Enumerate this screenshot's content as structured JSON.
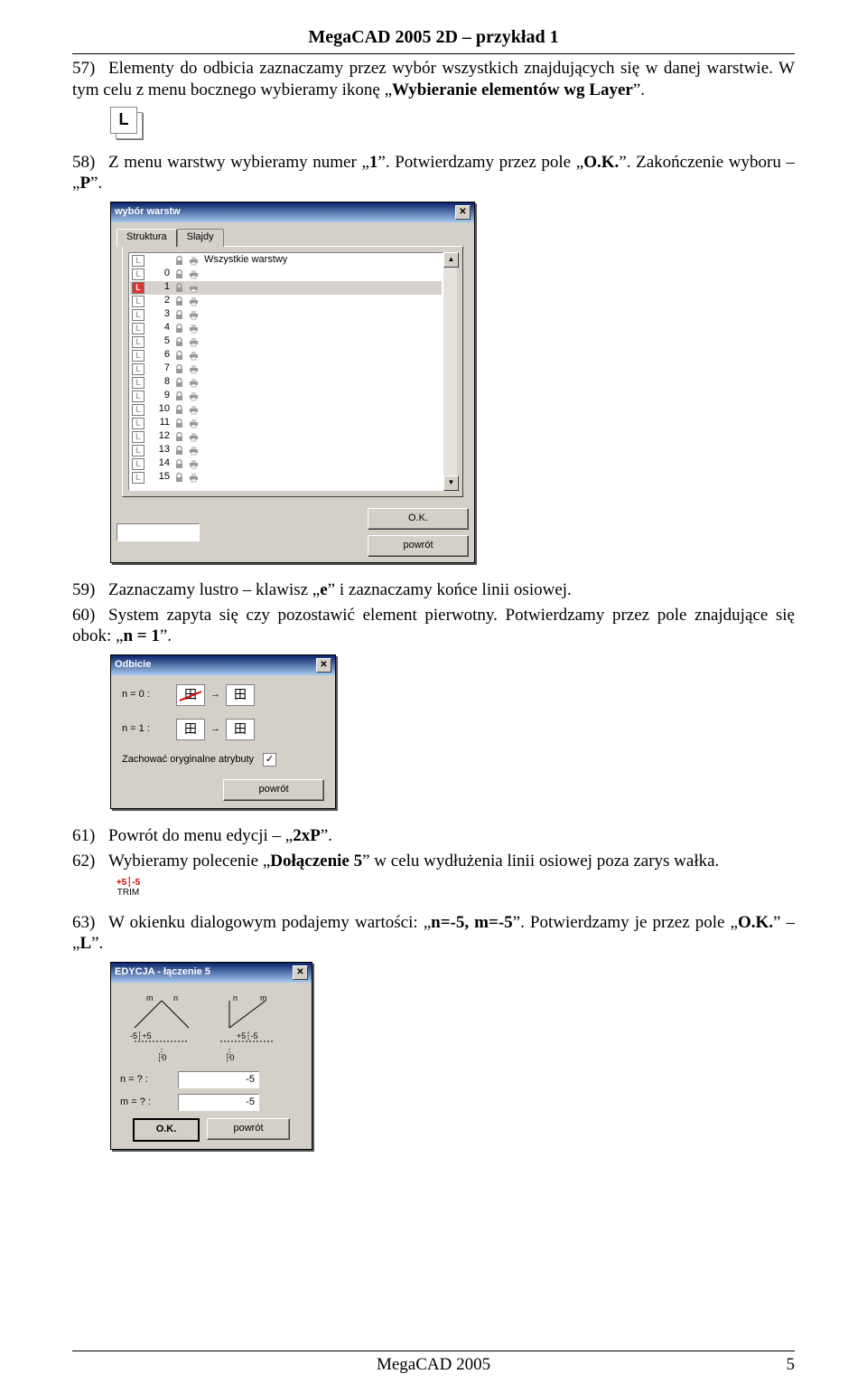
{
  "header": "MegaCAD 2005 2D – przykład 1",
  "footer": {
    "left": "MegaCAD 2005",
    "right": "5"
  },
  "p57": {
    "num": "57)",
    "text": "Elementy do odbicia zaznaczamy przez wybór wszystkich znajdujących się w danej warstwie. W tym celu z menu bocznego wybieramy ikonę „",
    "b1": "Wybieranie elementów wg Layer",
    "tail": "”."
  },
  "p58": {
    "num": "58)",
    "t1": "Z menu warstwy wybieramy numer „",
    "b1": "1",
    "t2": "”. Potwierdzamy przez pole „",
    "b2": "O.K.",
    "t3": "”. Zakończenie wyboru – „",
    "b3": "P",
    "t4": "”."
  },
  "p59": {
    "num": "59)",
    "t1": "Zaznaczamy lustro – klawisz „",
    "b1": "e",
    "t2": "” i zaznaczamy końce linii osiowej."
  },
  "p60": {
    "num": "60)",
    "t1": "System zapyta się czy pozostawić element pierwotny. Potwierdzamy przez pole znajdujące się obok: „",
    "b1": "n = 1",
    "t2": "”."
  },
  "p61": {
    "num": "61)",
    "t1": "Powrót do menu edycji – „",
    "b1": "2xP",
    "t2": "”."
  },
  "p62": {
    "num": "62)",
    "t1": "Wybieramy polecenie „",
    "b1": "Dołączenie 5",
    "t2": "” w celu wydłużenia linii osiowej poza zarys wałka."
  },
  "p63": {
    "num": "63)",
    "t1": "W okienku dialogowym podajemy wartości: „",
    "b1": "n=-5, m=-5",
    "t2": "”. Potwierdzamy je przez pole „",
    "b2": "O.K.",
    "t3": "” – „",
    "b3": "L",
    "t4": "”."
  },
  "dlgLayers": {
    "title": "wybór warstw",
    "tabs": {
      "t1": "Struktura",
      "t2": "Slajdy"
    },
    "headerName": "Wszystkie warstwy",
    "rows": [
      {
        "n": "0",
        "selected": false,
        "active": false
      },
      {
        "n": "1",
        "selected": true,
        "active": true
      },
      {
        "n": "2",
        "selected": false,
        "active": false
      },
      {
        "n": "3",
        "selected": false,
        "active": false
      },
      {
        "n": "4",
        "selected": false,
        "active": false
      },
      {
        "n": "5",
        "selected": false,
        "active": false
      },
      {
        "n": "6",
        "selected": false,
        "active": false
      },
      {
        "n": "7",
        "selected": false,
        "active": false
      },
      {
        "n": "8",
        "selected": false,
        "active": false
      },
      {
        "n": "9",
        "selected": false,
        "active": false
      },
      {
        "n": "10",
        "selected": false,
        "active": false
      },
      {
        "n": "11",
        "selected": false,
        "active": false
      },
      {
        "n": "12",
        "selected": false,
        "active": false
      },
      {
        "n": "13",
        "selected": false,
        "active": false
      },
      {
        "n": "14",
        "selected": false,
        "active": false
      },
      {
        "n": "15",
        "selected": false,
        "active": false
      }
    ],
    "ok": "O.K.",
    "back": "powrót"
  },
  "dlgMirror": {
    "title": "Odbicie",
    "n0": "n = 0 :",
    "n1": "n = 1 :",
    "keepAttrs": "Zachować oryginalne atrybuty",
    "checked": true,
    "back": "powrót"
  },
  "trim": {
    "top": "+5┆-5",
    "label": "TRIM"
  },
  "dlgEdy": {
    "title": "EDYCJA - łączenie 5",
    "diagLabels": {
      "m": "m",
      "n": "n",
      "l1": "-5┆+5",
      "l2": "+5┆-5",
      "zero": "┆0"
    },
    "nLbl": "n = ? :",
    "mLbl": "m = ? :",
    "nVal": "-5",
    "mVal": "-5",
    "ok": "O.K.",
    "back": "powrót"
  }
}
